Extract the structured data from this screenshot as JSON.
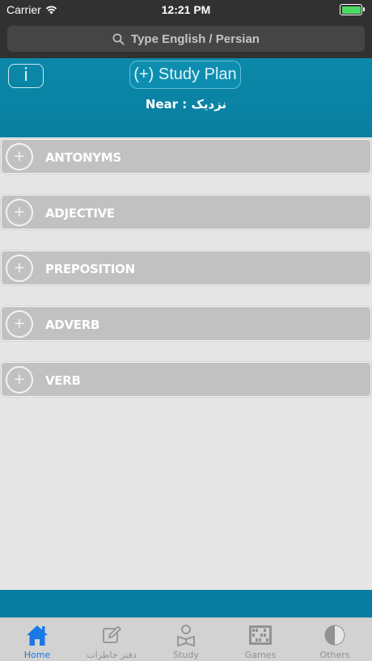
{
  "status_bar": {
    "carrier": "Carrier",
    "time": "12:21 PM"
  },
  "search": {
    "placeholder": "Type English / Persian"
  },
  "header": {
    "info_label": "i",
    "study_plan_label": "(+) Study Plan",
    "word_title": "Near : نزدیک"
  },
  "sections": [
    {
      "plus": "+",
      "label": "ANTONYMS"
    },
    {
      "plus": "+",
      "label": "ADJECTIVE"
    },
    {
      "plus": "+",
      "label": "PREPOSITION"
    },
    {
      "plus": "+",
      "label": "ADVERB"
    },
    {
      "plus": "+",
      "label": "VERB"
    }
  ],
  "tabs": [
    {
      "label": "Home",
      "icon": "home-icon",
      "active": true
    },
    {
      "label": "دفتر خاطرات",
      "icon": "notebook-edit-icon",
      "active": false
    },
    {
      "label": "Study",
      "icon": "study-icon",
      "active": false
    },
    {
      "label": "Games",
      "icon": "abacus-icon",
      "active": false
    },
    {
      "label": "Others",
      "icon": "pie-icon",
      "active": false
    }
  ],
  "colors": {
    "accent_blue": "#0b88a9",
    "tab_active": "#1a78e8",
    "battery_green": "#4cd964"
  }
}
